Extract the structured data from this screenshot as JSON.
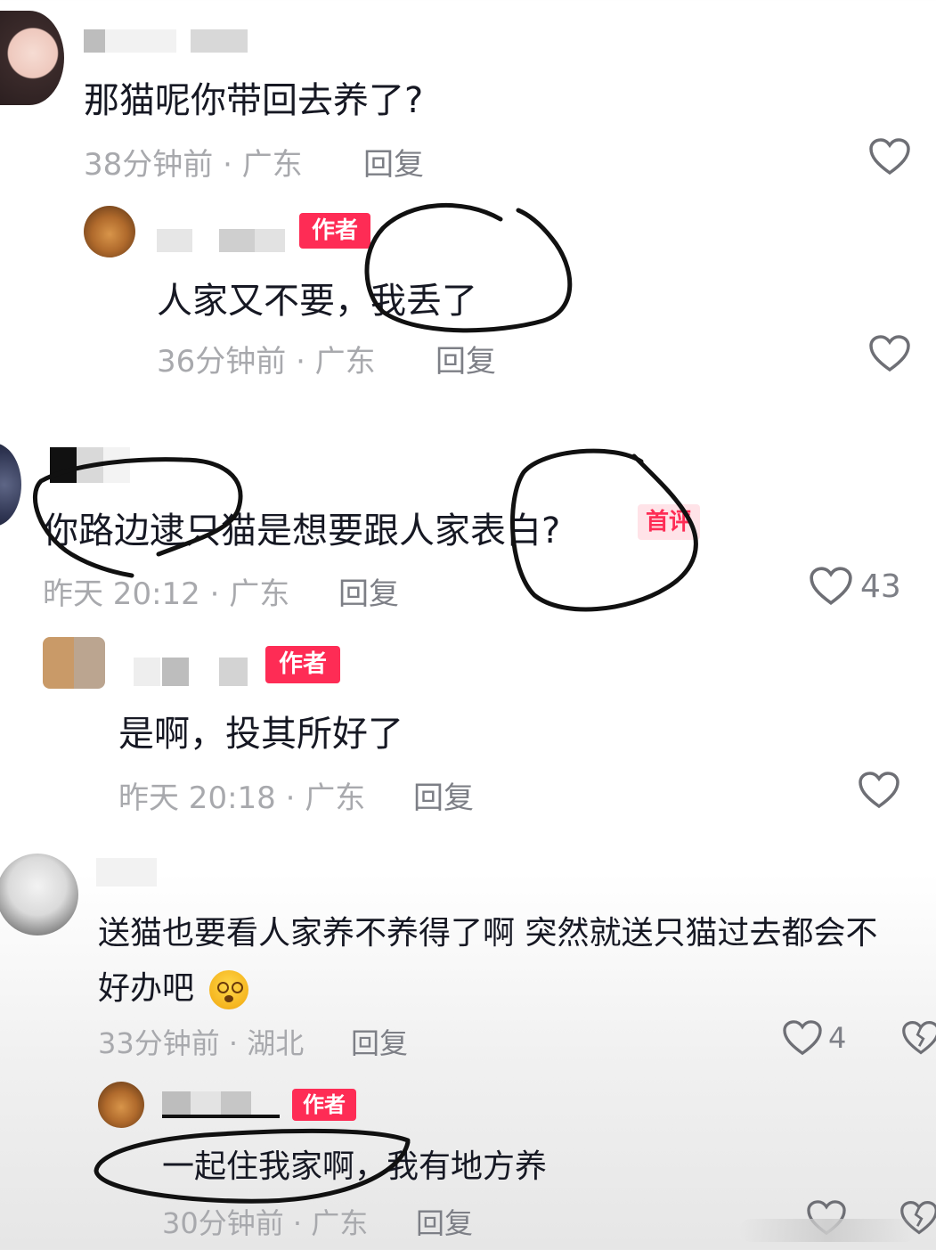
{
  "comments": [
    {
      "text": "那猫呢你带回去养了?",
      "time_location": "38分钟前 · 广东",
      "reply_label": "回复"
    },
    {
      "author_tag": "作者",
      "text": "人家又不要，我丢了",
      "time_location": "36分钟前 · 广东",
      "reply_label": "回复"
    },
    {
      "text": "你路边逮只猫是想要跟人家表白?",
      "first_tag": "首评",
      "time_location": "昨天 20:12 · 广东",
      "reply_label": "回复",
      "likes": "43"
    },
    {
      "author_tag": "作者",
      "text": "是啊，投其所好了",
      "time_location": "昨天 20:18 · 广东",
      "reply_label": "回复"
    },
    {
      "text_line1": "送猫也要看人家养不养得了啊 突然就送只猫过去都会不",
      "text_line2": "好办吧",
      "time_location": "33分钟前 · 湖北",
      "reply_label": "回复",
      "likes": "4"
    },
    {
      "author_tag": "作者",
      "text": "一起住我家啊，我有地方养",
      "time_location": "30分钟前 · 广东",
      "reply_label": "回复"
    }
  ],
  "colors": {
    "author_tag": "#fe2c55",
    "meta_text": "#a8a9ad",
    "annotation": "#111111"
  },
  "icons": [
    "heart-icon",
    "dislike-heart-icon",
    "dizzy-face-emoji"
  ]
}
